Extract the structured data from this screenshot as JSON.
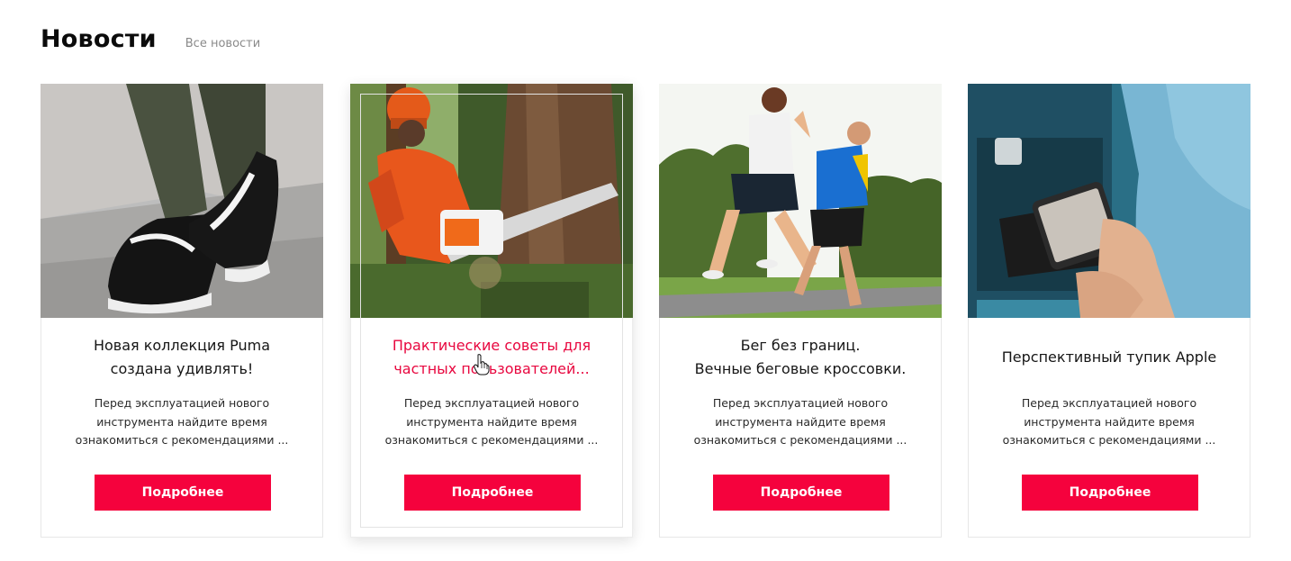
{
  "header": {
    "title": "Новости",
    "all_news_link": "Все новости"
  },
  "cards": [
    {
      "image": "puma-sneakers-photo",
      "title_lines": [
        "Новая коллекция Puma",
        "создана удивлять!"
      ],
      "text_lines": [
        "Перед эксплуатацией нового",
        "инструмента найдите время",
        "ознакомиться с рекомендациями ..."
      ],
      "button": "Подробнее"
    },
    {
      "image": "chainsaw-lumberjack-photo",
      "title_lines": [
        "Практические советы для",
        "частных пользователей..."
      ],
      "text_lines": [
        "Перед эксплуатацией нового",
        "инструмента найдите время",
        "ознакомиться с рекомендациями ..."
      ],
      "button": "Подробнее",
      "hovered": true
    },
    {
      "image": "running-couple-photo",
      "title_lines": [
        "Бег без границ.",
        "Вечные беговые кроссовки."
      ],
      "text_lines": [
        "Перед эксплуатацией нового",
        "инструмента найдите время",
        "ознакомиться с рекомендациями ..."
      ],
      "button": "Подробнее"
    },
    {
      "image": "smartphone-hands-photo",
      "title_lines": [
        "Перспективный тупик Apple"
      ],
      "text_lines": [
        "Перед эксплуатацией нового",
        "инструмента найдите время",
        "ознакомиться с рекомендациями ..."
      ],
      "button": "Подробнее"
    }
  ],
  "colors": {
    "accent": "#f5023d",
    "hover_title": "#e8073f",
    "muted_link": "#8a8a8a"
  }
}
